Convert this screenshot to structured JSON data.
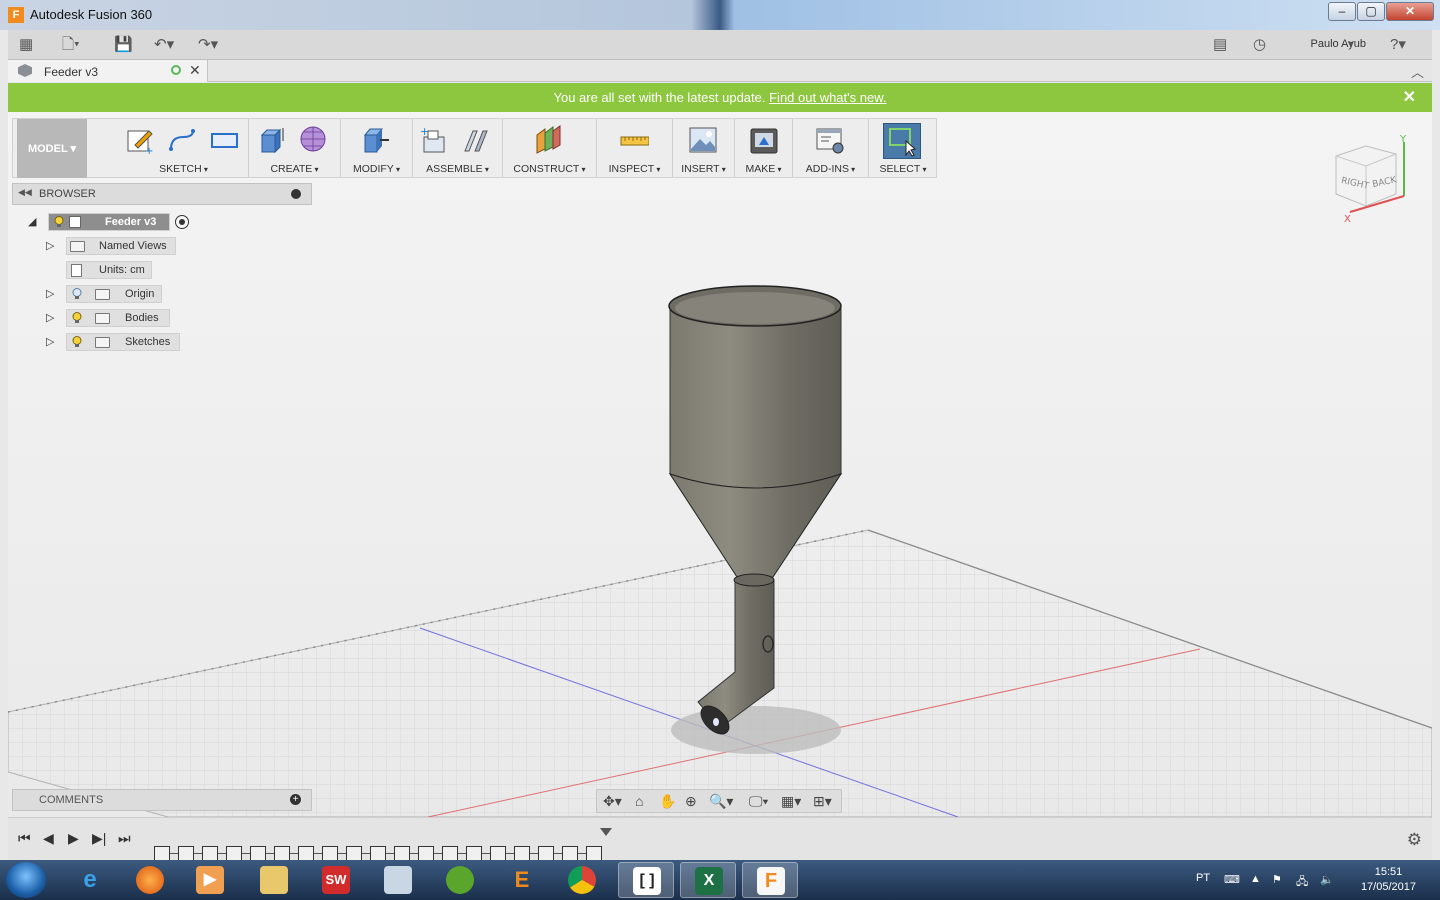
{
  "window": {
    "title": "Autodesk Fusion 360",
    "app_icon": "F"
  },
  "appbar": {
    "user": "Paulo Ayub"
  },
  "document": {
    "tab_label": "Feeder v3"
  },
  "notification": {
    "text": "You are all set with the latest update.",
    "link": "Find out what's new."
  },
  "ribbon": {
    "workspace": "MODEL",
    "groups": [
      "SKETCH",
      "CREATE",
      "MODIFY",
      "ASSEMBLE",
      "CONSTRUCT",
      "INSPECT",
      "INSERT",
      "MAKE",
      "ADD-INS",
      "SELECT"
    ]
  },
  "browser": {
    "title": "BROWSER",
    "root": "Feeder v3",
    "items": [
      "Named Views",
      "Units: cm",
      "Origin",
      "Bodies",
      "Sketches"
    ]
  },
  "viewcube": {
    "right": "RIGHT",
    "back": "BACK",
    "axis_x": "X",
    "axis_y": "Y"
  },
  "comments": {
    "title": "COMMENTS"
  },
  "taskbar": {
    "lang": "PT",
    "time": "15:51",
    "date": "17/05/2017"
  },
  "colors": {
    "notice": "#8dc63f",
    "select_active": "#4a7aa8"
  }
}
